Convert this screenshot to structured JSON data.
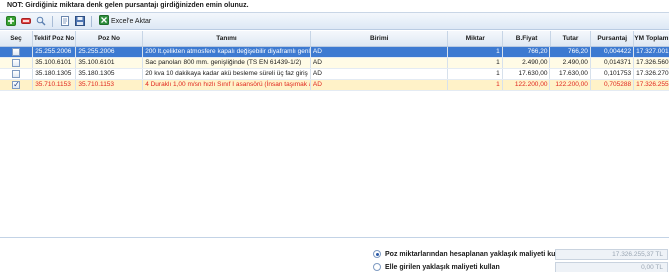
{
  "note": "NOT: Girdiğiniz miktara denk gelen pursantajı girdiğinizden emin olunuz.",
  "toolbar": {
    "icons": [
      "add-icon",
      "remove-icon",
      "search-icon",
      "document-icon",
      "save-icon"
    ],
    "excel_label": "Excel'e Aktar"
  },
  "grid": {
    "columns": [
      "Seç",
      "Teklif Poz No",
      "Poz No",
      "Tanımı",
      "Birimi",
      "Miktar",
      "B.Fiyat",
      "Tutar",
      "Pursantaj",
      "YM Toplamı"
    ],
    "rows": [
      {
        "checked": false,
        "teklif_poz_no": "25.255.2006",
        "poz_no": "25.255.2006",
        "tanimi": "200 lt.çelikten atmosfere kapalı değişebilir diyaframlı genleşme",
        "birimi": "AD",
        "miktar": "1",
        "bfiyat": "766,20",
        "tutar": "766,20",
        "pursantaj": "0,004422",
        "ym_toplami": "17.327.001,36"
      },
      {
        "checked": false,
        "teklif_poz_no": "35.100.6101",
        "poz_no": "35.100.6101",
        "tanimi": "Sac panoları 800 mm. genişliğinde (TS EN 61439-1/2)",
        "birimi": "AD",
        "miktar": "1",
        "bfiyat": "2.490,00",
        "tutar": "2.490,00",
        "pursantaj": "0,014371",
        "ym_toplami": "17.326.560,43"
      },
      {
        "checked": false,
        "teklif_poz_no": "35.180.1305",
        "poz_no": "35.180.1305",
        "tanimi": "20 kva 10 dakikaya kadar akü besleme süreli üç faz giriş üç faz ç",
        "birimi": "AD",
        "miktar": "1",
        "bfiyat": "17.630,00",
        "tutar": "17.630,00",
        "pursantaj": "0,101753",
        "ym_toplami": "17.326.270,48"
      },
      {
        "checked": true,
        "teklif_poz_no": "35.710.1153",
        "poz_no": "35.710.1153",
        "tanimi": "4 Duraklı 1,00 m/sn hızlı Sınıf I asansörü (İnsan taşımak amacıyl",
        "birimi": "AD",
        "miktar": "1",
        "bfiyat": "122.200,00",
        "tutar": "122.200,00",
        "pursantaj": "0,705288",
        "ym_toplami": "17.326.255,37"
      }
    ]
  },
  "options": {
    "option1_label": "Poz miktarlarından hesaplanan yaklaşık maliyeti kullan",
    "option1_value": "17.326.255,37 TL",
    "option1_selected": true,
    "option2_label": "Elle girilen yaklaşık maliyeti kullan",
    "option2_value": "0,00 TL",
    "option2_selected": false
  },
  "colors": {
    "selected_row": "#3d7ad1",
    "checked_row_text": "#e0261e",
    "alt_row": "#fffbe6"
  }
}
